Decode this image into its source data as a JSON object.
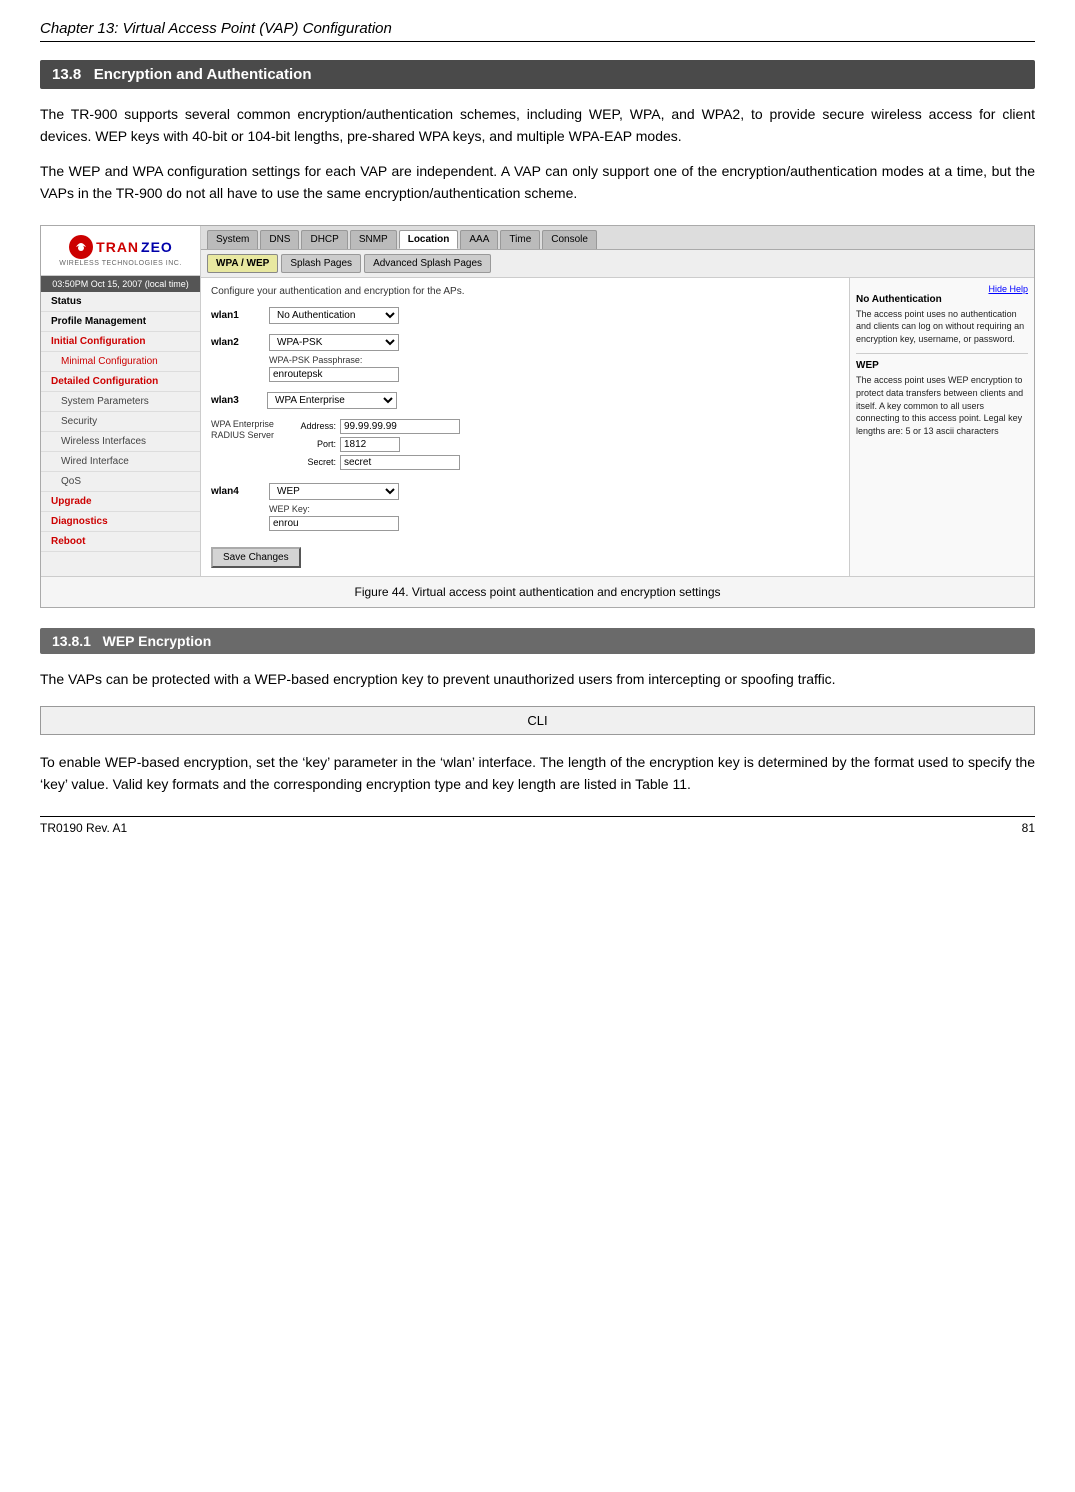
{
  "page": {
    "chapter_header": "Chapter 13: Virtual Access Point (VAP) Configuration",
    "footer_left": "TR0190 Rev. A1",
    "footer_right": "81"
  },
  "section_138": {
    "id": "13.8",
    "title": "Encryption and Authentication",
    "para1": "The TR-900 supports several common encryption/authentication schemes, including WEP, WPA, and WPA2, to provide secure wireless access for client devices. WEP keys with 40-bit or 104-bit lengths, pre-shared WPA keys, and multiple WPA-EAP modes.",
    "para2": "The WEP and WPA configuration settings for each VAP are independent. A VAP can only support one of the encryption/authentication modes at a time, but the VAPs in the TR-900 do not all have to use the same encryption/authentication scheme."
  },
  "router_ui": {
    "time": "03:50PM Oct 15, 2007 (local time)",
    "sidebar": {
      "items": [
        {
          "label": "Status",
          "style": "bold"
        },
        {
          "label": "Profile Management",
          "style": "bold"
        },
        {
          "label": "Initial Configuration",
          "style": "red"
        },
        {
          "label": "Minimal Configuration",
          "style": "indented"
        },
        {
          "label": "Detailed Configuration",
          "style": "red"
        },
        {
          "label": "System Parameters",
          "style": "plain"
        },
        {
          "label": "Security",
          "style": "plain"
        },
        {
          "label": "Wireless Interfaces",
          "style": "plain"
        },
        {
          "label": "Wired Interface",
          "style": "plain"
        },
        {
          "label": "QoS",
          "style": "plain"
        },
        {
          "label": "Upgrade",
          "style": "red"
        },
        {
          "label": "Diagnostics",
          "style": "red"
        },
        {
          "label": "Reboot",
          "style": "red"
        }
      ]
    },
    "tabs": [
      "System",
      "DNS",
      "DHCP",
      "SNMP",
      "Location",
      "AAA",
      "Time",
      "Console"
    ],
    "active_tab": "Location",
    "subtabs": [
      "WPA / WEP",
      "Splash Pages",
      "Advanced Splash Pages"
    ],
    "active_subtab": "WPA / WEP",
    "form": {
      "description": "Configure your authentication and encryption for the APs.",
      "wlan1": {
        "label": "wlan1",
        "auth": "No Authentication"
      },
      "wlan2": {
        "label": "wlan2",
        "auth": "WPA-PSK",
        "passphrase_label": "WPA-PSK Passphrase:",
        "passphrase_value": "enroutepsk"
      },
      "wlan3": {
        "label": "wlan3",
        "auth": "WPA Enterprise",
        "radius_label": "WPA Enterprise RADIUS Server",
        "address_label": "Address:",
        "address_value": "99.99.99.99",
        "port_label": "Port:",
        "port_value": "1812",
        "secret_label": "Secret:",
        "secret_value": "secret"
      },
      "wlan4": {
        "label": "wlan4",
        "auth": "WEP",
        "key_label": "WEP Key:",
        "key_value": "enrou"
      },
      "save_button": "Save Changes"
    },
    "help": {
      "hide_link": "Hide Help",
      "no_auth_title": "No Authentication",
      "no_auth_text": "The access point uses no authentication and clients can log on without requiring an encryption key, username, or password.",
      "wep_title": "WEP",
      "wep_text": "The access point uses WEP encryption to protect data transfers between clients and itself. A key common to all users connecting to this access point. Legal key lengths are: 5 or 13 ascii characters"
    }
  },
  "figure": {
    "caption": "Figure 44. Virtual access point authentication and encryption settings"
  },
  "section_1381": {
    "id": "13.8.1",
    "title": "WEP Encryption",
    "para1": "The VAPs can be protected with a WEP-based encryption key to prevent unauthorized users from intercepting or spoofing traffic.",
    "cli_label": "CLI",
    "para2": "To enable WEP-based encryption, set the ‘key’ parameter in the ‘wlan’ interface. The length of the encryption key is determined by the format used to specify the ‘key’ value. Valid key formats and the corresponding encryption type and key length are listed in Table 11."
  }
}
